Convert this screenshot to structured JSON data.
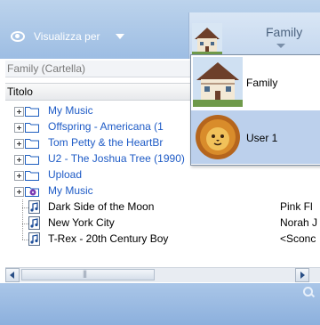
{
  "toolbar": {
    "view_by_label": "Visualizza per",
    "current_user": "Family"
  },
  "breadcrumb": "Family (Cartella)",
  "column_header": "Titolo",
  "tree": [
    {
      "type": "folder",
      "label": "My Music",
      "expandable": true
    },
    {
      "type": "folder",
      "label": "Offspring - Americana (1",
      "expandable": true
    },
    {
      "type": "folder",
      "label": "Tom Petty & the HeartBr",
      "expandable": true
    },
    {
      "type": "folder",
      "label": "U2 - The Joshua Tree (1990)",
      "expandable": true
    },
    {
      "type": "folder",
      "label": "Upload",
      "expandable": true
    },
    {
      "type": "playlist",
      "label": "My Music",
      "expandable": true
    },
    {
      "type": "track",
      "label": "Dark Side of the Moon",
      "artist": "Pink Fl"
    },
    {
      "type": "track",
      "label": "New York City",
      "artist": "Norah J"
    },
    {
      "type": "track",
      "label": "T-Rex - 20th Century Boy",
      "artist": "<Sconc"
    }
  ],
  "dropdown": {
    "items": [
      {
        "label": "Family",
        "selected": false,
        "icon": "house-icon"
      },
      {
        "label": "User 1",
        "selected": true,
        "icon": "lion-icon"
      }
    ]
  },
  "colors": {
    "toolbar_top": "#bcd3ec",
    "toolbar_bottom": "#9dbde3",
    "link_blue": "#1e5bc6",
    "selected_bg": "#bcd0ec"
  }
}
